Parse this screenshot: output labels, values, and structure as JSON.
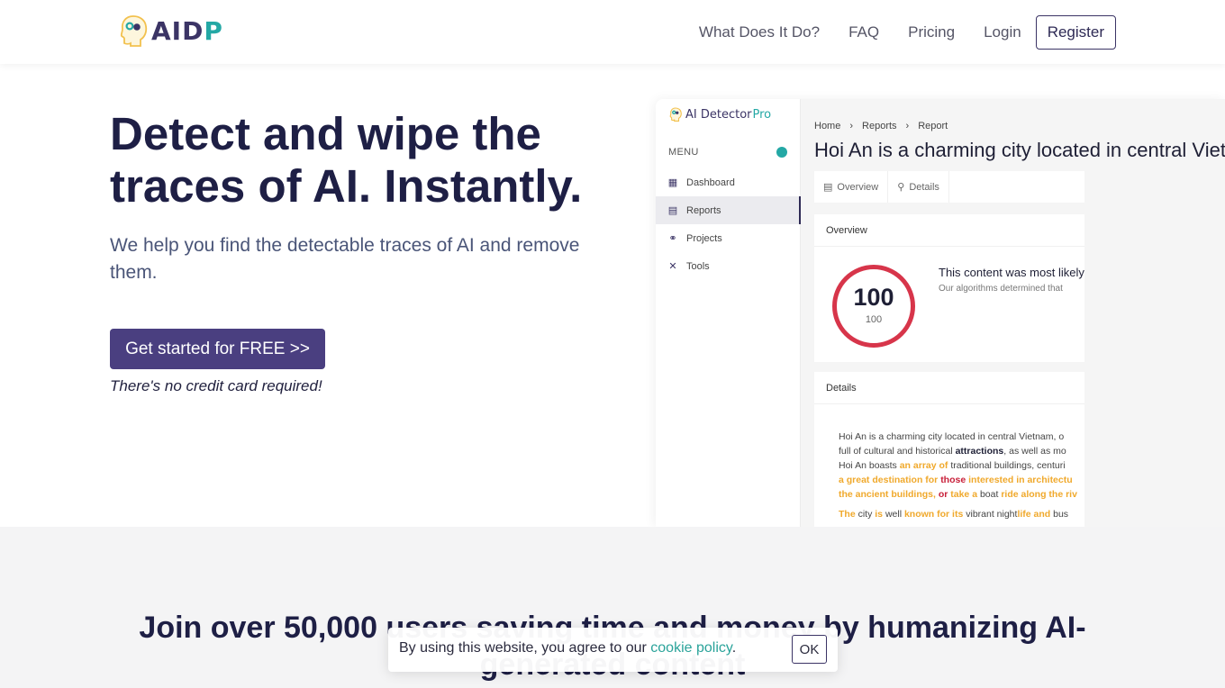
{
  "header": {
    "logo_text_main": "AID",
    "logo_text_accent": "P",
    "nav": [
      {
        "label": "What Does It Do?"
      },
      {
        "label": "FAQ"
      },
      {
        "label": "Pricing"
      },
      {
        "label": "Login"
      }
    ],
    "register_label": "Register"
  },
  "hero": {
    "title": "Detect and wipe the traces of AI. Instantly.",
    "subtitle": "We help you find the detectable traces of AI and remove them.",
    "cta_label": "Get started for FREE >>",
    "cta_note": "There's no credit card required!"
  },
  "preview": {
    "brand_main": "AI Detector ",
    "brand_accent": "Pro",
    "menu_label": "MENU",
    "sidebar": [
      {
        "label": "Dashboard",
        "icon": "grid-icon"
      },
      {
        "label": "Reports",
        "icon": "report-icon",
        "active": true
      },
      {
        "label": "Projects",
        "icon": "projects-icon"
      },
      {
        "label": "Tools",
        "icon": "tools-icon"
      }
    ],
    "breadcrumbs": [
      "Home",
      "Reports",
      "Report"
    ],
    "report_title": "Hoi An is a charming city located in central Vietnam",
    "tabs": [
      {
        "label": "Overview",
        "icon": "table-icon"
      },
      {
        "label": "Details",
        "icon": "search-icon"
      }
    ],
    "overview": {
      "heading": "Overview",
      "score": "100",
      "score_max": "100",
      "verdict_title": "This content was most likely",
      "verdict_sub": "Our algorithms determined that"
    },
    "details": {
      "heading": "Details",
      "lines": [
        [
          {
            "t": "Hoi An is a charming city located in central Vietnam, o",
            "c": ""
          }
        ],
        [
          {
            "t": "full of cultural and historical ",
            "c": ""
          },
          {
            "t": "attractions",
            "c": "b"
          },
          {
            "t": ", as well as mo",
            "c": ""
          }
        ],
        [
          {
            "t": "Hoi An boasts ",
            "c": ""
          },
          {
            "t": "an array of",
            "c": "o"
          },
          {
            "t": " traditional buildings, centuri",
            "c": ""
          }
        ],
        [
          {
            "t": "a great destination for ",
            "c": "o"
          },
          {
            "t": "those",
            "c": "r"
          },
          {
            "t": " interested in architectu",
            "c": "o"
          }
        ],
        [
          {
            "t": "the ancient buildings, ",
            "c": "o"
          },
          {
            "t": "or",
            "c": "r"
          },
          {
            "t": " take a",
            "c": "o"
          },
          {
            "t": " boat ",
            "c": ""
          },
          {
            "t": "ride along the riv",
            "c": "o"
          }
        ],
        [
          {
            "t": "The",
            "c": "o"
          },
          {
            "t": " city ",
            "c": ""
          },
          {
            "t": "is",
            "c": "o"
          },
          {
            "t": " well ",
            "c": ""
          },
          {
            "t": "known for its",
            "c": "o"
          },
          {
            "t": " vibrant night",
            "c": ""
          },
          {
            "t": "life and",
            "c": "o"
          },
          {
            "t": " bus",
            "c": ""
          }
        ]
      ]
    }
  },
  "lower": {
    "join_title": "Join over 50,000 users saving time and money by humanizing AI-generated content"
  },
  "cookie": {
    "text": "By using this website, you agree to our ",
    "link": "cookie policy",
    "suffix": ".",
    "ok_label": "OK"
  },
  "colors": {
    "brand_purple": "#4a3f80",
    "brand_teal": "#24a8a5",
    "score_red": "#d7354a",
    "highlight_orange": "#f0a92c",
    "highlight_red": "#c8203a"
  }
}
